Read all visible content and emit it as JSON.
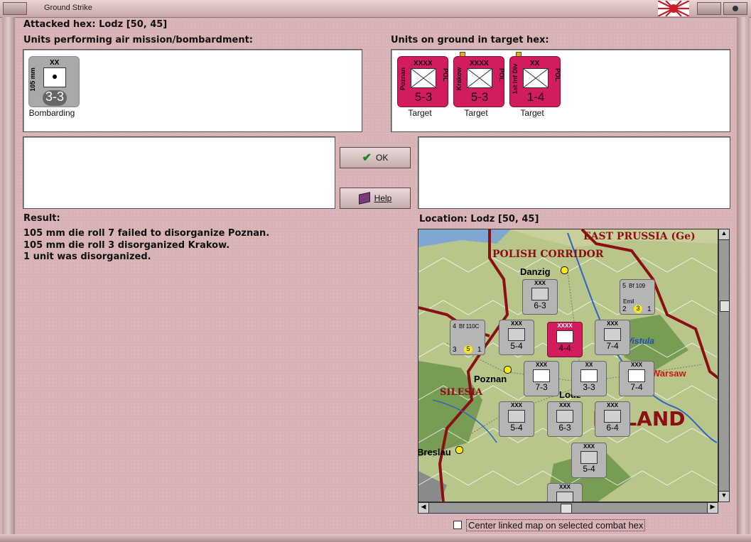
{
  "window": {
    "title": "Ground Strike"
  },
  "header": {
    "attacked_hex": "Attacked hex: Lodz  [50, 45]"
  },
  "air_panel": {
    "label": "Units performing air mission/bombardment:",
    "unit": {
      "size": "XX",
      "side_text": "105 mm",
      "strength": "3-3",
      "caption": "Bombarding"
    }
  },
  "ground_panel": {
    "label": "Units on ground in target hex:",
    "units": [
      {
        "size": "XXXX",
        "name": "Poznan",
        "nation": "POL",
        "strength": "5-3",
        "caption": "Target"
      },
      {
        "size": "XXXX",
        "name": "Krakow",
        "nation": "POL",
        "strength": "5-3",
        "caption": "Target"
      },
      {
        "size": "XX",
        "name": "1st Inf Div",
        "nation": "POL",
        "strength": "1-4",
        "caption": "Target"
      }
    ]
  },
  "buttons": {
    "ok": "OK",
    "help": "Help"
  },
  "result": {
    "label": "Result:",
    "lines": [
      "105 mm die roll 7 failed to disorganize Poznan.",
      "105 mm die roll 3 disorganized Krakow.",
      "1 unit was disorganized."
    ]
  },
  "location": {
    "label": "Location:  Lodz  [50, 45]",
    "map": {
      "regions": [
        "EAST PRUSSIA (Ge)",
        "POLISH CORRIDOR",
        "SILESIA",
        "POLAND"
      ],
      "cities": [
        "Danzig",
        "Poznan",
        "Lodz",
        "Warsaw",
        "Breslau"
      ],
      "river": "Vistula",
      "units": [
        {
          "id": "u1",
          "strength": "6-3",
          "size": "XXX"
        },
        {
          "id": "u2",
          "strength": "5-4",
          "size": "XXX"
        },
        {
          "id": "u3",
          "strength": "4-4",
          "size": "XXXX"
        },
        {
          "id": "u4",
          "strength": "7-4",
          "size": "XXX"
        },
        {
          "id": "u5",
          "strength": "7-3",
          "size": "XXX"
        },
        {
          "id": "u6",
          "strength": "3-3",
          "size": "XX"
        },
        {
          "id": "u7",
          "strength": "7-4",
          "size": "XXX"
        },
        {
          "id": "u8",
          "strength": "5-4",
          "size": "XXX"
        },
        {
          "id": "u9",
          "strength": "6-3",
          "size": "XXX"
        },
        {
          "id": "u10",
          "strength": "6-4",
          "size": "XXX"
        },
        {
          "id": "u11",
          "strength": "5-4",
          "size": "XXX"
        },
        {
          "id": "u12",
          "strength": "",
          "size": "XXX"
        }
      ],
      "air_units": [
        {
          "name": "Bf 109",
          "sub": "Emil",
          "left": "2",
          "mid": "3",
          "top": "5",
          "right": "1"
        },
        {
          "name": "Bf 110C",
          "sub": "",
          "left": "3",
          "mid": "5",
          "top": "4",
          "right": "1"
        }
      ]
    }
  },
  "checkbox": {
    "label": "Center linked map on selected combat hex",
    "checked": false
  },
  "colors": {
    "accent_red": "#d21c5d",
    "frame": "#d9b4b6",
    "map_green": "#b9c78a"
  }
}
